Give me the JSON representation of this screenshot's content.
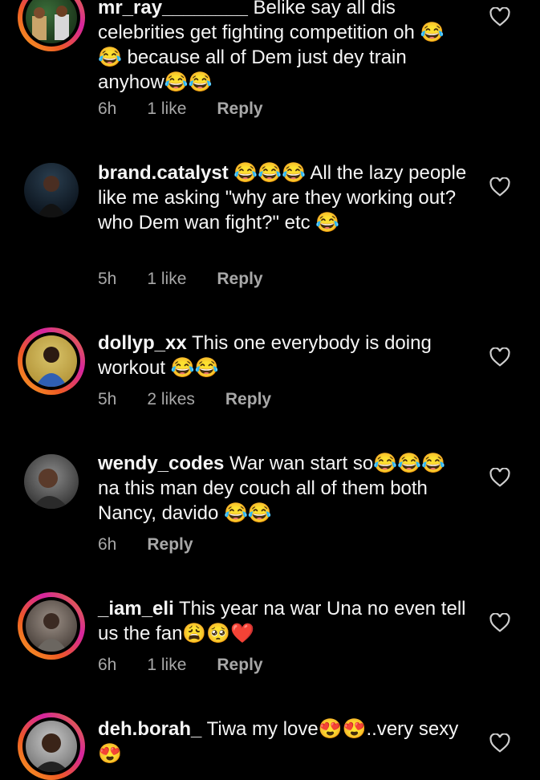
{
  "comments": [
    {
      "username": "mr_ray________",
      "text_parts": [
        "Belike say all dis celebrities get fighting competition oh ",
        "😂😂",
        " because all of Dem just dey train anyhow",
        "😂😂"
      ],
      "time": "6h",
      "likes": "1 like",
      "reply": "Reply",
      "story_ring": true
    },
    {
      "username": "brand.catalyst",
      "text_parts": [
        "😂😂😂",
        " All the lazy people like me asking \"why are they working out? who Dem wan fight?\" etc ",
        "😂"
      ],
      "time": "5h",
      "likes": "1 like",
      "reply": "Reply",
      "story_ring": false
    },
    {
      "username": "dollyp_xx",
      "text_parts": [
        "This one everybody is doing workout ",
        "😂😂"
      ],
      "time": "5h",
      "likes": "2 likes",
      "reply": "Reply",
      "story_ring": true
    },
    {
      "username": "wendy_codes",
      "text_parts": [
        "War wan start so",
        "😂😂😂",
        " na this man dey couch all of them both Nancy, davido ",
        "😂😂"
      ],
      "time": "6h",
      "likes": "",
      "reply": "Reply",
      "story_ring": false
    },
    {
      "username": "_iam_eli",
      "text_parts": [
        "This year na war Una no even tell us the fan",
        "😩🥺❤️"
      ],
      "time": "6h",
      "likes": "1 like",
      "reply": "Reply",
      "story_ring": true
    },
    {
      "username": "deh.borah_",
      "text_parts": [
        "Tiwa my love",
        "😍😍",
        "..very sexy",
        "😍"
      ],
      "time": "",
      "likes": "",
      "reply": "",
      "story_ring": true
    }
  ],
  "colors": {
    "background": "#000000",
    "text": "#f5f5f5",
    "meta": "#a8a8a8",
    "heart_outline": "#cfcfcf"
  },
  "icons": {
    "like": "heart-outline-icon",
    "laugh": "face-with-tears-of-joy-emoji",
    "weary": "weary-face-emoji",
    "pleading": "pleading-face-emoji",
    "red_heart": "red-heart-emoji",
    "heart_eyes": "heart-eyes-emoji"
  }
}
